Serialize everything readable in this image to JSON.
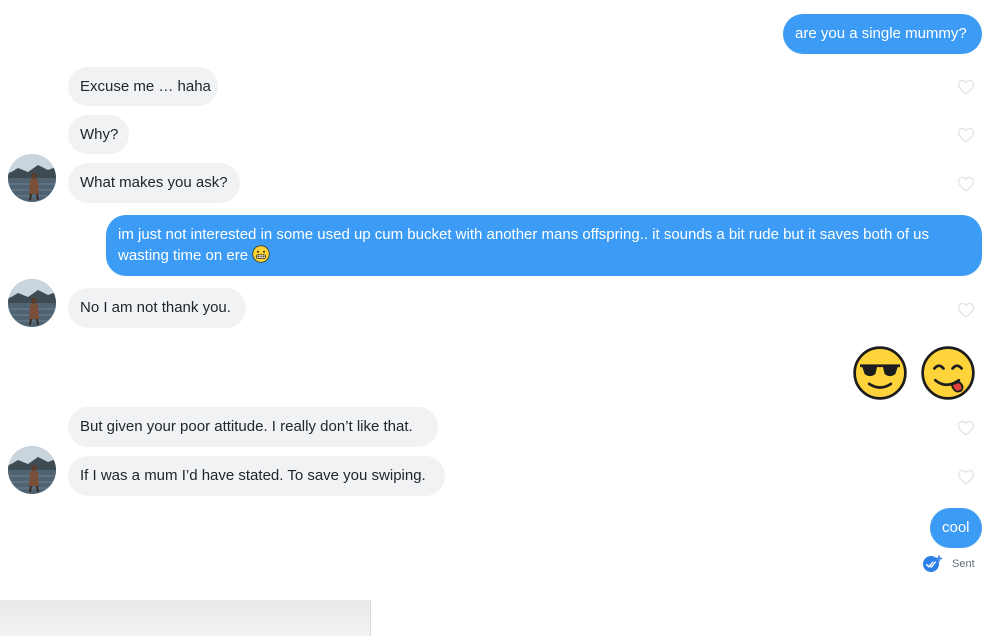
{
  "messages": {
    "m1": "are you a single mummy?",
    "m2": "Excuse me … haha",
    "m3": "Why?",
    "m4": "What makes you ask?",
    "m5": "im just not interested in some used up cum bucket with another mans offspring.. it sounds a bit rude but it saves both of us wasting time on ere",
    "m6": "No I am not thank you.",
    "m8": "But given your poor attitude. I really don’t like that.",
    "m9": "If I was a mum I’d have stated. To save you swiping.",
    "m10": "cool"
  },
  "emojis": {
    "m5_inline": "grimacing-face-emoji",
    "m7": [
      "smiling-face-with-sunglasses-emoji",
      "face-savoring-food-emoji"
    ]
  },
  "receipt": {
    "status_label": "Sent",
    "icon": "sent-check-icon"
  },
  "icons": {
    "like": "heart-outline-icon",
    "avatar": "lake-photo-avatar"
  },
  "colors": {
    "sent_bubble": "#3c9cf5",
    "received_bubble": "#f0f2f4",
    "heart_outline": "#e2e5e8",
    "receipt_icon": "#2b7de9"
  }
}
